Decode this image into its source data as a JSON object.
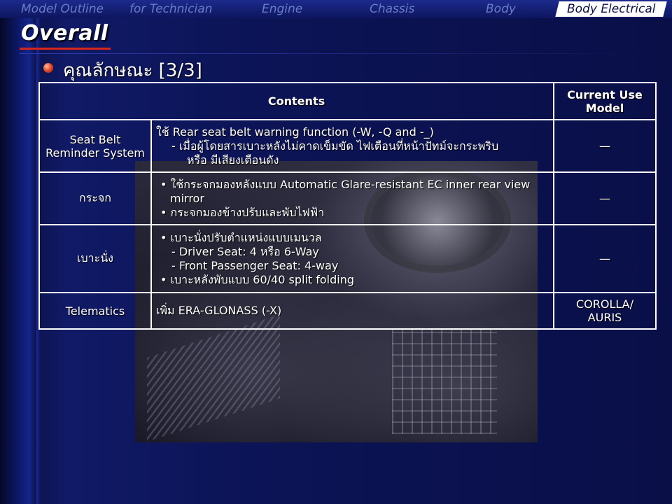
{
  "nav": {
    "items": [
      {
        "label": "Model Outline",
        "active": false
      },
      {
        "label": "for Technician",
        "active": false
      },
      {
        "label": "Engine",
        "active": false
      },
      {
        "label": "Chassis",
        "active": false
      },
      {
        "label": "Body",
        "active": false
      },
      {
        "label": "Body Electrical",
        "active": true
      }
    ]
  },
  "page": {
    "title": "Overall",
    "subtitle": "คุณลักษณะ [3/3]"
  },
  "table": {
    "headers": {
      "contents": "Contents",
      "model": "Current Use Model"
    },
    "rows": [
      {
        "category": "Seat Belt Reminder System",
        "lines": [
          "ใช้ Rear seat belt warning function (-W, -Q and -_)",
          "- เมื่อผู้โดยสารเบาะหลังไม่คาดเข็มขัด ไฟเตือนที่หน้าปัทม์จะกระพริบ",
          "หรือ มีเสียงเตือนดัง"
        ],
        "model": "—"
      },
      {
        "category": "กระจก",
        "lines": [
          "• ใช้กระจกมองหลังแบบ Automatic Glare-resistant EC inner rear view mirror",
          "• กระจกมองข้างปรับและพับไฟฟ้า"
        ],
        "model": "—"
      },
      {
        "category": "เบาะนั่ง",
        "lines": [
          "• เบาะนั่งปรับตำแหน่งแบบเมนวล",
          "- Driver Seat: 4 หรือ 6-Way",
          "- Front Passenger Seat: 4-way",
          "• เบาะหลังพับแบบ 60/40 split folding"
        ],
        "model": "—"
      },
      {
        "category": "Telematics",
        "lines": [
          "เพิ่ม ERA-GLONASS (-X)"
        ],
        "model": "COROLLA/ AURIS"
      }
    ]
  },
  "colors": {
    "background": "#0b1250",
    "accent": "#d8261c",
    "nav_active_bg": "#ffffff",
    "nav_text": "#6a7bc8"
  },
  "icons": {
    "subtitle_bullet": "red-ball-bullet-icon"
  }
}
